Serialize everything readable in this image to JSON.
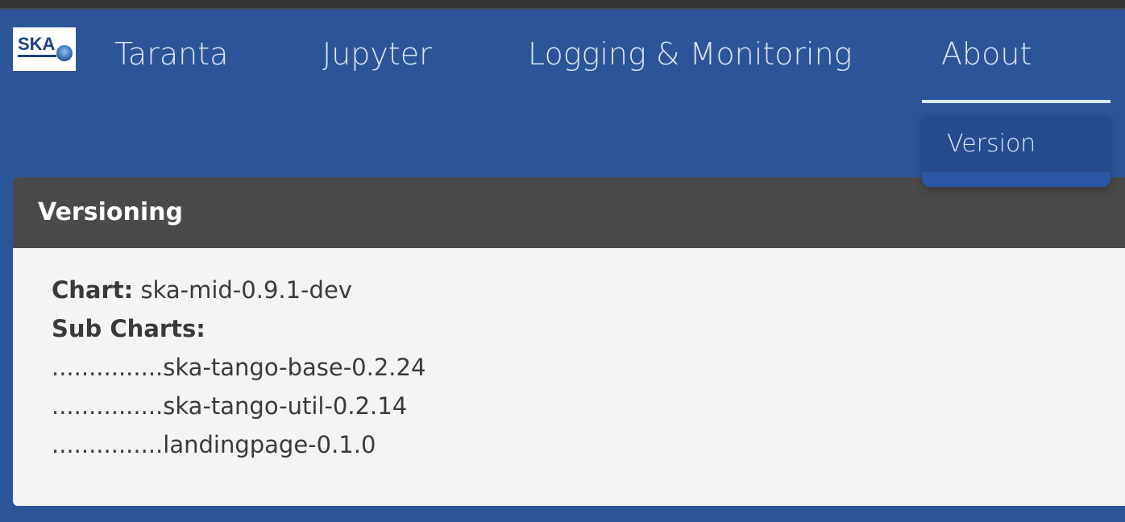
{
  "logo": {
    "text": "SKA"
  },
  "nav": {
    "items": [
      {
        "label": "Taranta"
      },
      {
        "label": "Jupyter"
      },
      {
        "label": "Logging & Monitoring"
      },
      {
        "label": "About"
      }
    ]
  },
  "dropdown": {
    "items": [
      {
        "label": "Version"
      }
    ]
  },
  "card": {
    "title": "Versioning",
    "chart_label": "Chart:",
    "chart_value": "ska-mid-0.9.1-dev",
    "subcharts_label": "Sub Charts:",
    "subcharts": [
      "...............ska-tango-base-0.2.24",
      "...............ska-tango-util-0.2.14",
      "...............landingpage-0.1.0"
    ]
  },
  "colors": {
    "background": "#2c5599",
    "card_header": "#4a4a4a",
    "card_body": "#f4f4f4",
    "dropdown": "#244c8f"
  }
}
